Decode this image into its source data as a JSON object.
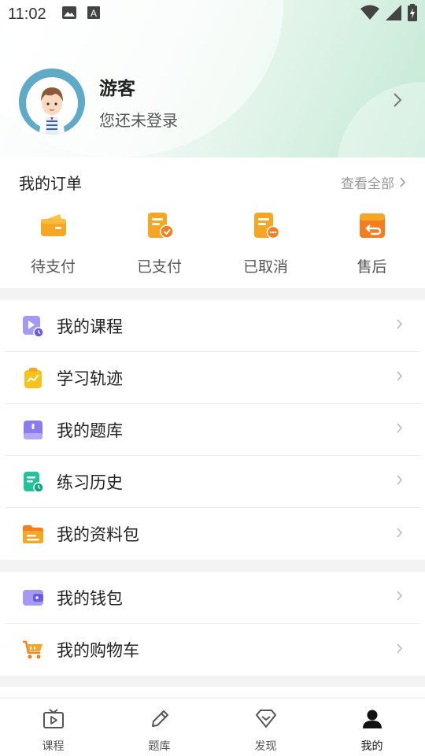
{
  "status_bar": {
    "time": "11:02",
    "icons_left": [
      "image-icon",
      "a-badge-icon"
    ],
    "icons_right": [
      "wifi-icon",
      "signal-icon",
      "battery-charging-icon"
    ]
  },
  "profile": {
    "name": "游客",
    "subtitle": "您还未登录",
    "avatar_icon": "cartoon-boy-avatar"
  },
  "orders": {
    "title": "我的订单",
    "view_all": "查看全部",
    "items": [
      {
        "label": "待支付",
        "icon": "wallet-icon",
        "color": "#f5a623"
      },
      {
        "label": "已支付",
        "icon": "paid-doc-icon",
        "color": "#f5a623"
      },
      {
        "label": "已取消",
        "icon": "cancelled-doc-icon",
        "color": "#f5a623"
      },
      {
        "label": "售后",
        "icon": "return-box-icon",
        "color": "#f57c1f"
      }
    ]
  },
  "menu_group_1": [
    {
      "label": "我的课程",
      "icon": "course-play-icon",
      "color": "#7c6cf0"
    },
    {
      "label": "学习轨迹",
      "icon": "learning-track-icon",
      "color": "#f7c21a"
    },
    {
      "label": "我的题库",
      "icon": "question-bank-icon",
      "color": "#7c6cf0"
    },
    {
      "label": "练习历史",
      "icon": "practice-history-icon",
      "color": "#22c39a"
    },
    {
      "label": "我的资料包",
      "icon": "folder-icon",
      "color": "#f5a623"
    }
  ],
  "menu_group_2": [
    {
      "label": "我的钱包",
      "icon": "wallet-purple-icon",
      "color": "#7c6cf0"
    },
    {
      "label": "我的购物车",
      "icon": "shopping-cart-icon",
      "color": "#f57c1f"
    }
  ],
  "tabbar": {
    "tabs": [
      {
        "label": "课程",
        "icon": "tv-play-icon"
      },
      {
        "label": "题库",
        "icon": "pencil-icon"
      },
      {
        "label": "发现",
        "icon": "diamond-icon"
      },
      {
        "label": "我的",
        "icon": "person-icon"
      }
    ],
    "active": "我的"
  }
}
